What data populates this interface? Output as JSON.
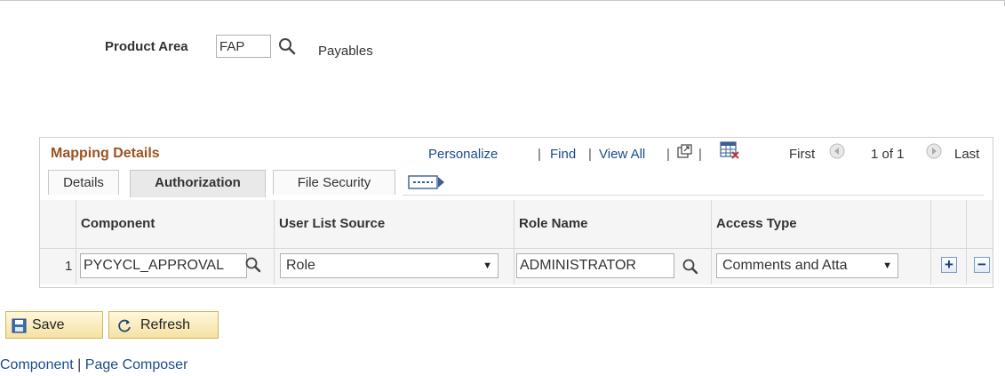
{
  "product_area": {
    "label": "Product Area",
    "value": "FAP",
    "description": "Payables"
  },
  "grid": {
    "title": "Mapping Details",
    "nav": {
      "personalize": "Personalize",
      "find": "Find",
      "view_all": "View All",
      "first": "First",
      "range": "1 of 1",
      "last": "Last",
      "separator": "|"
    },
    "tabs": [
      "Details",
      "Authorization",
      "File Security"
    ],
    "columns": [
      "Component",
      "User List Source",
      "Role Name",
      "Access Type"
    ],
    "rows": [
      {
        "num": "1",
        "component": "PYCYCL_APPROVAL",
        "user_list_source": "Role",
        "role_name": "ADMINISTRATOR",
        "access_type": "Comments and Atta"
      }
    ],
    "add_label": "+",
    "remove_label": "−"
  },
  "buttons": {
    "save": "Save",
    "refresh": "Refresh"
  },
  "footer": {
    "component": "Component",
    "separator": "|",
    "page_composer": "Page Composer"
  },
  "colors": {
    "title": "#9c5220",
    "link": "#1a4c8c"
  }
}
